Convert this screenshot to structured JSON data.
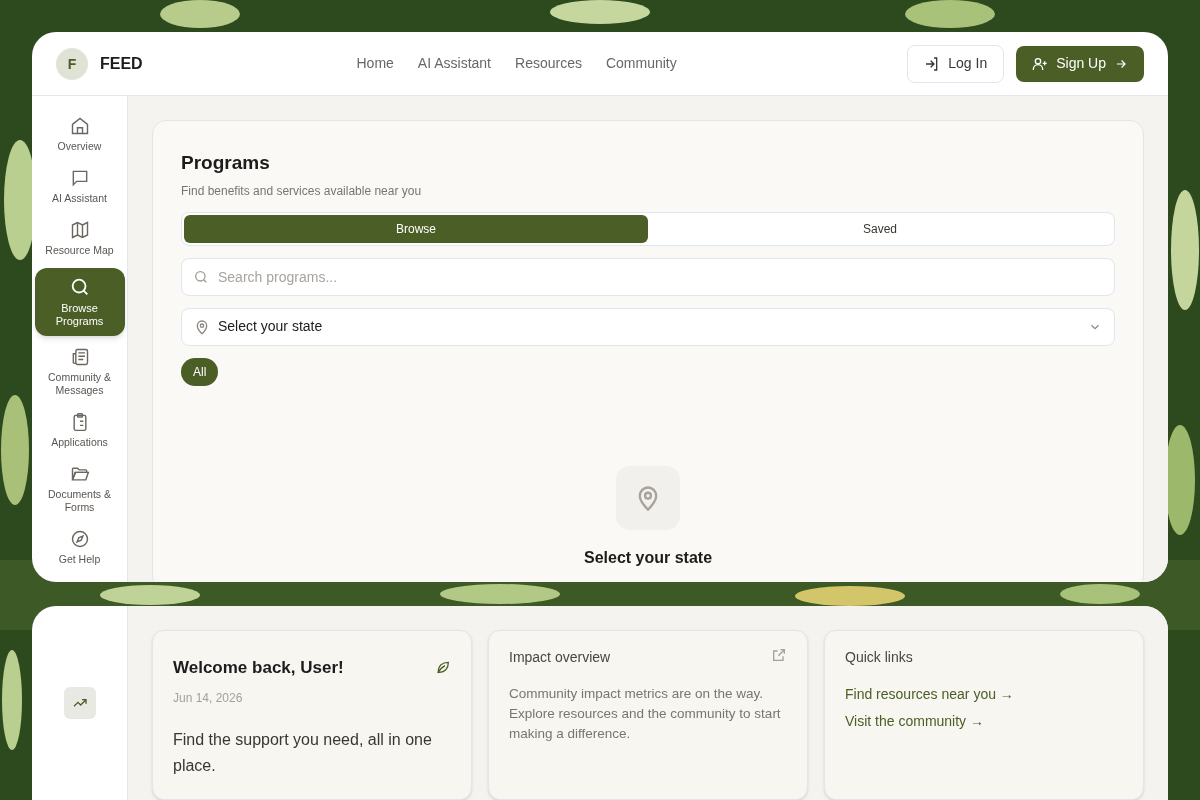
{
  "brand": {
    "initial": "F",
    "name": "FEED"
  },
  "nav": [
    "Home",
    "AI Assistant",
    "Resources",
    "Community"
  ],
  "auth": [
    {
      "kind": "login",
      "label": "Log In"
    },
    {
      "kind": "signup",
      "label": "Sign Up"
    }
  ],
  "sidebar": {
    "items": [
      {
        "kind": "home",
        "label": "Overview",
        "selected": false
      },
      {
        "kind": "chat",
        "label": "AI Assistant",
        "selected": false
      },
      {
        "kind": "map",
        "label": "Resource Map",
        "selected": false
      },
      {
        "kind": "search",
        "label": "Browse Programs",
        "selected": true
      },
      {
        "kind": "news",
        "label": "Community & Messages",
        "selected": false
      },
      {
        "kind": "clipboard",
        "label": "Applications",
        "selected": false
      },
      {
        "kind": "folder",
        "label": "Documents & Forms",
        "selected": false
      },
      {
        "kind": "compass",
        "label": "Get Help",
        "selected": false
      }
    ]
  },
  "programs": {
    "title": "Programs",
    "subtitle": "Find benefits and services available near you",
    "tabs": [
      {
        "label": "Browse",
        "selected": true
      },
      {
        "label": "Saved",
        "selected": false
      }
    ],
    "search": {
      "placeholder": "Search programs..."
    },
    "state_select": {
      "value": "Select your state"
    },
    "filters": [
      {
        "label": "All",
        "selected": true
      }
    ],
    "empty_state": {
      "title": "Select your state"
    }
  },
  "cards": [
    {
      "kind": "welcome",
      "title": "Welcome back, User!",
      "date": "Jun 14, 2026",
      "body": "Find the support you need, all in one place."
    },
    {
      "kind": "impact",
      "title": "Impact overview",
      "body": "Community impact metrics are on the way. Explore resources and the community to start making a difference."
    },
    {
      "kind": "links",
      "title": "Quick links",
      "links": [
        "Find resources near you →",
        "Visit the community →"
      ]
    }
  ]
}
